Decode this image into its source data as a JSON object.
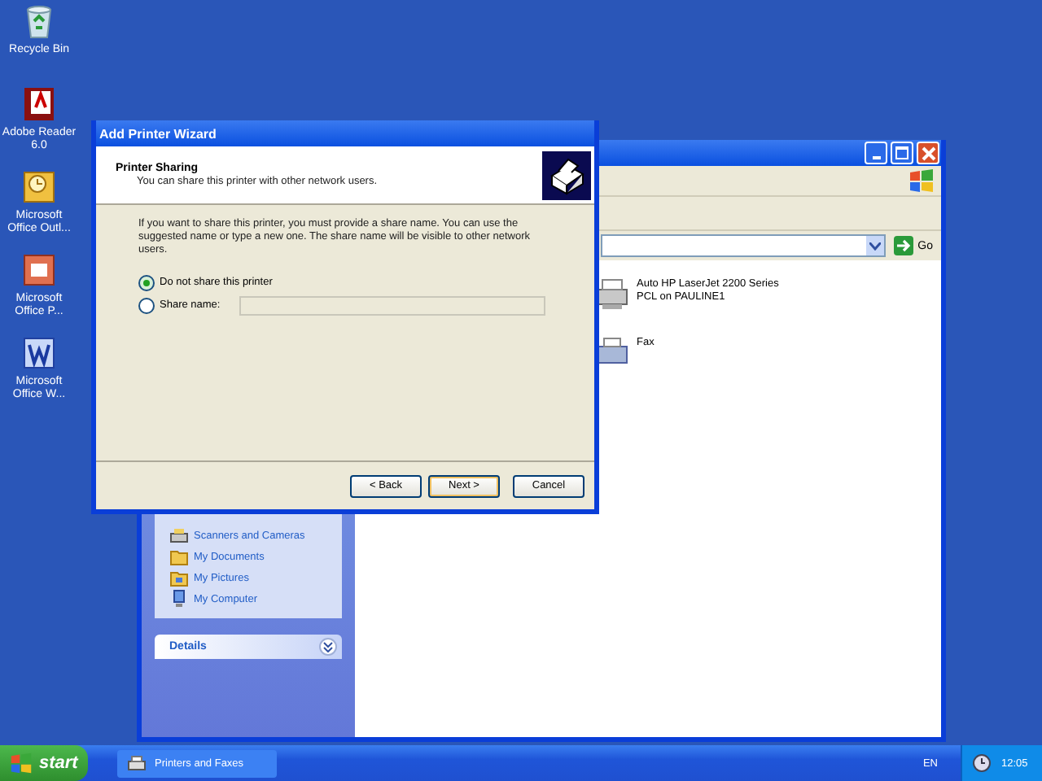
{
  "desktop_icons": [
    {
      "label": "Recycle Bin",
      "kind": "recycle"
    },
    {
      "label": "Adobe Reader 6.0",
      "kind": "reader"
    },
    {
      "label": "Microsoft Office Outl...",
      "kind": "outlook"
    },
    {
      "label": "Microsoft Office P...",
      "kind": "powerpoint"
    },
    {
      "label": "Microsoft Office W...",
      "kind": "word"
    }
  ],
  "explorer": {
    "go_button": "Go",
    "tasks": [
      {
        "label": "Scanners and Cameras",
        "kind": "scanner"
      },
      {
        "label": "My Documents",
        "kind": "folder"
      },
      {
        "label": "My Pictures",
        "kind": "pictures"
      },
      {
        "label": "My Computer",
        "kind": "computer"
      }
    ],
    "details_title": "Details",
    "printers": [
      {
        "name": "Auto HP LaserJet 2200 Series",
        "detail": "PCL on PAULINE1",
        "kind": "printer"
      },
      {
        "name": "Fax",
        "kind": "fax"
      }
    ]
  },
  "wizard": {
    "title": "Add Printer Wizard",
    "heading": "Printer Sharing",
    "subheading": "You can share this printer with other network users.",
    "intro": "If you want to share this printer, you must provide a share name. You can use the suggested name or type a new one. The share name will be visible to other network users.",
    "options": [
      {
        "label": "Do not share this printer",
        "selected": true,
        "kind": "plain"
      },
      {
        "label": "Share name:",
        "selected": false,
        "kind": "field"
      }
    ],
    "share_field_disabled": true,
    "buttons": [
      {
        "label": "< Back",
        "default": false
      },
      {
        "label": "Next >",
        "default": true
      },
      {
        "label": "Cancel",
        "default": false
      }
    ]
  },
  "taskbar": {
    "start": "start",
    "tasks": [
      {
        "label": "Printers and Faxes",
        "selected": false
      }
    ],
    "language": "EN",
    "clock": "12:05"
  }
}
